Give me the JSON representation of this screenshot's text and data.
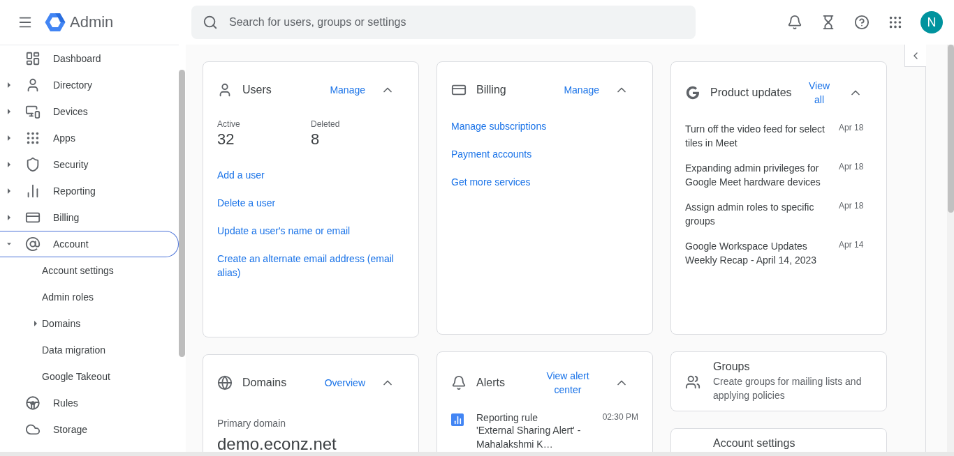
{
  "header": {
    "title": "Admin",
    "search": {
      "placeholder": "Search for users, groups or settings"
    },
    "avatar": "N"
  },
  "sidebar": {
    "items": [
      {
        "label": "Dashboard",
        "selected": false
      },
      {
        "label": "Directory",
        "expanded": false,
        "selected": false
      },
      {
        "label": "Devices",
        "expanded": false,
        "selected": false
      },
      {
        "label": "Apps",
        "expanded": false,
        "selected": false
      },
      {
        "label": "Security",
        "expanded": false,
        "selected": false
      },
      {
        "label": "Reporting",
        "expanded": false,
        "selected": false
      },
      {
        "label": "Billing",
        "expanded": false,
        "selected": false
      },
      {
        "label": "Account",
        "expanded": true,
        "selected": true,
        "children": [
          {
            "label": "Account settings",
            "selected": false
          },
          {
            "label": "Admin roles",
            "selected": false
          },
          {
            "label": "Domains",
            "expanded": false,
            "selected": false
          },
          {
            "label": "Data migration",
            "selected": false
          },
          {
            "label": "Google Takeout",
            "selected": false
          }
        ]
      },
      {
        "label": "Rules",
        "selected": false
      },
      {
        "label": "Storage",
        "selected": false
      }
    ]
  },
  "columns": [
    [
      {
        "kind": "users",
        "title": "Users",
        "action": "Manage",
        "expanded": true,
        "stats": [
          {
            "label": "Active",
            "value": "32"
          },
          {
            "label": "Deleted",
            "value": "8"
          }
        ],
        "links": [
          "Add a user",
          "Delete a user",
          "Update a user's name or email",
          "Create an alternate email address (email alias)"
        ]
      },
      {
        "kind": "domains",
        "title": "Domains",
        "action": "Overview",
        "expanded": true,
        "label": "Primary domain",
        "value": "demo.econz.net"
      }
    ],
    [
      {
        "kind": "billing",
        "title": "Billing",
        "action": "Manage",
        "expanded": true,
        "links": [
          "Manage subscriptions",
          "Payment accounts",
          "Get more services"
        ]
      },
      {
        "kind": "alerts",
        "title": "Alerts",
        "action": "View alert center",
        "expanded": true,
        "items": [
          {
            "title": "Reporting rule",
            "time": "02:30 PM",
            "text": "'External Sharing Alert' - Mahalakshmi K…"
          }
        ]
      }
    ],
    [
      {
        "kind": "updates",
        "title": "Product updates",
        "action": "View all",
        "expanded": true,
        "items": [
          {
            "text": "Turn off the video feed for select tiles in Meet",
            "date": "Apr 18"
          },
          {
            "text": "Expanding admin privileges for Google Meet hardware devices",
            "date": "Apr 18"
          },
          {
            "text": "Assign admin roles to specific groups",
            "date": "Apr 18"
          },
          {
            "text": "Google Workspace Updates Weekly Recap - April 14, 2023",
            "date": "Apr 14"
          }
        ]
      },
      {
        "kind": "groups",
        "title": "Groups",
        "description": "Create groups for mailing lists and applying policies"
      },
      {
        "kind": "account",
        "title": "Account settings"
      }
    ]
  ]
}
